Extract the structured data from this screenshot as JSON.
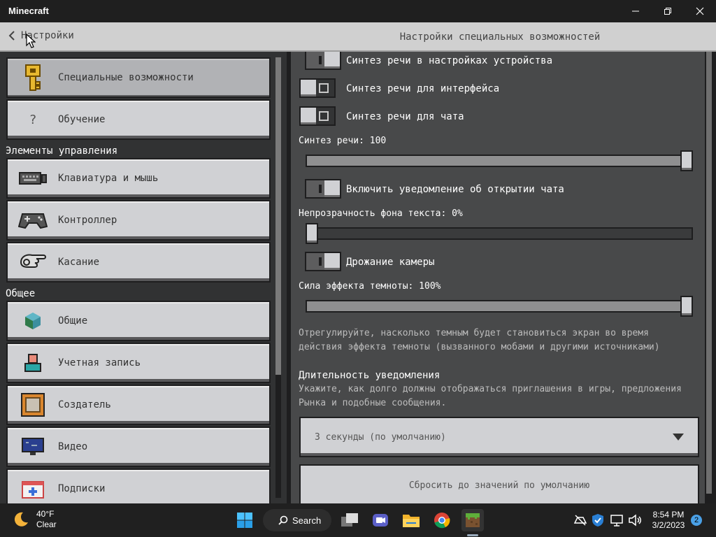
{
  "window": {
    "title": "Minecraft"
  },
  "header": {
    "back_label": "Настройки",
    "page_title": "Настройки специальных возможностей"
  },
  "sidebar": {
    "items_top": [
      {
        "label": "Специальные возможности",
        "icon": "key-icon",
        "active": true
      },
      {
        "label": "Обучение",
        "icon": "question-icon"
      }
    ],
    "section_controls": "Элементы управления",
    "items_controls": [
      {
        "label": "Клавиатура и мышь",
        "icon": "keyboard-mouse-icon"
      },
      {
        "label": "Контроллер",
        "icon": "gamepad-icon"
      },
      {
        "label": "Касание",
        "icon": "touch-icon"
      }
    ],
    "section_general": "Общее",
    "items_general": [
      {
        "label": "Общие",
        "icon": "cube-icon"
      },
      {
        "label": "Учетная запись",
        "icon": "account-icon"
      },
      {
        "label": "Создатель",
        "icon": "creator-icon"
      },
      {
        "label": "Видео",
        "icon": "monitor-icon"
      },
      {
        "label": "Подписки",
        "icon": "subscriptions-icon"
      }
    ]
  },
  "settings": {
    "tts_device": {
      "label": "Синтез речи в настройках устройства",
      "state": "on"
    },
    "tts_ui": {
      "label": "Синтез речи для интерфейса",
      "state": "off"
    },
    "tts_chat": {
      "label": "Синтез речи для чата",
      "state": "off"
    },
    "tts_volume": {
      "label": "Синтез речи: 100",
      "value": 100
    },
    "chat_open_notify": {
      "label": "Включить уведомление об открытии чата",
      "state": "on"
    },
    "text_bg_opacity": {
      "label": "Непрозрачность фона текста: 0%",
      "value": 0
    },
    "camera_shake": {
      "label": "Дрожание камеры",
      "state": "on"
    },
    "darkness_effect": {
      "label": "Сила эффекта темноты: 100%",
      "value": 100
    },
    "darkness_desc_1": "Отрегулируйте, насколько темным будет становиться экран во время",
    "darkness_desc_2": "действия эффекта темноты (вызванного мобами и другими источниками)",
    "notify_heading": "Длительность уведомления",
    "notify_desc_1": "Укажите, как долго должны отображаться приглашения в игры, предложения",
    "notify_desc_2": "Рынка и подобные сообщения.",
    "notify_dropdown_value": "3 секунды (по умолчанию)",
    "reset_label": "Сбросить до значений по умолчанию"
  },
  "taskbar": {
    "weather_temp": "40°F",
    "weather_cond": "Clear",
    "search_label": "Search",
    "time": "8:54 PM",
    "date": "3/2/2023",
    "notifications": "2"
  }
}
